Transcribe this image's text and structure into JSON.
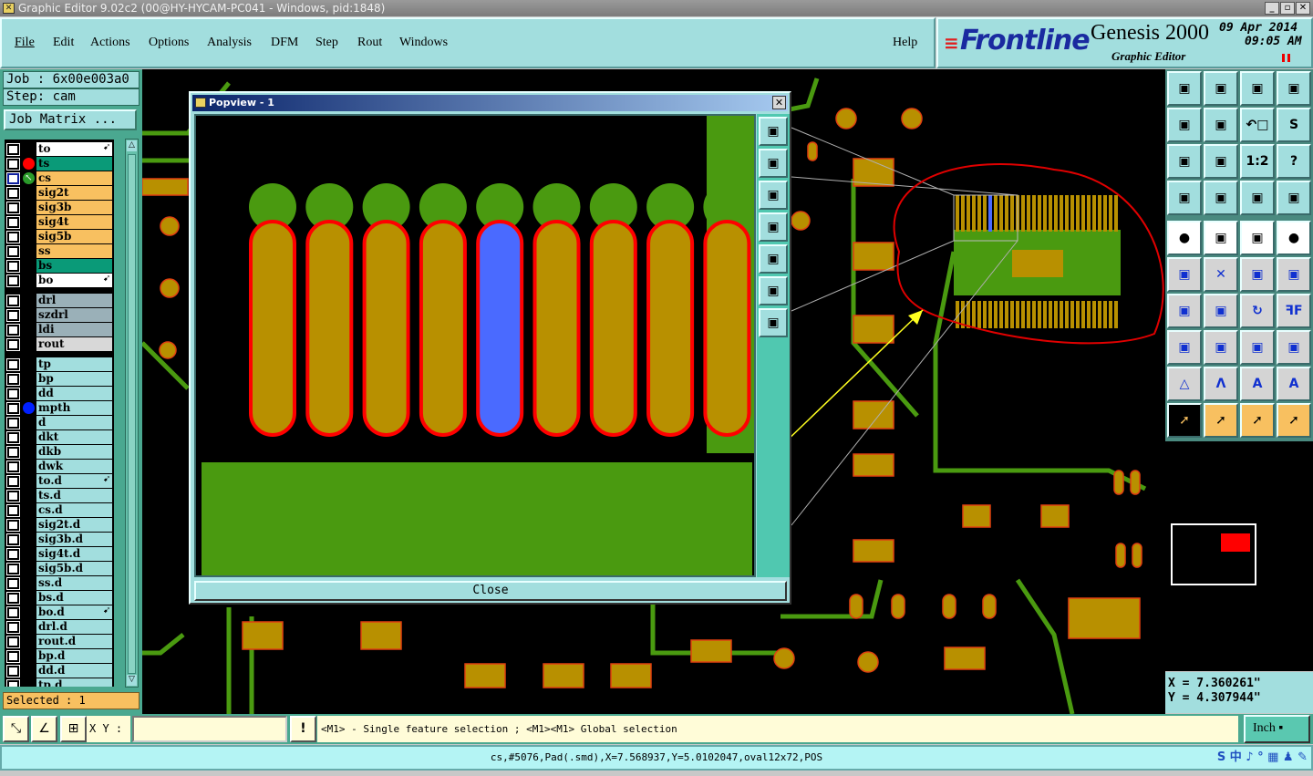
{
  "window": {
    "title": "Graphic Editor 9.02c2 (00@HY-HYCAM-PC041 - Windows, pid:1848)",
    "minimize": "_",
    "restore": "▫",
    "close": "✕"
  },
  "menu": {
    "items": [
      "File",
      "Edit",
      "Actions",
      "Options",
      "Analysis",
      "DFM",
      "Step",
      "Rout",
      "Windows"
    ],
    "help": "Help"
  },
  "logo": {
    "brand": "Frontline",
    "product": "Genesis 2000",
    "subtitle": "Graphic Editor",
    "date": "09 Apr 2014",
    "time": "09:05 AM"
  },
  "job": {
    "job_label": "Job : 6x00e003a0",
    "step_label": "Step: cam",
    "matrix_button": "Job Matrix ..."
  },
  "layers": [
    {
      "name": "to",
      "color": "#ffffff",
      "mark": true
    },
    {
      "name": "ts",
      "color": "#0a9a78",
      "dot": "#ff0000"
    },
    {
      "name": "cs",
      "color": "#f8c060",
      "work": true
    },
    {
      "name": "sig2t",
      "color": "#f8c060"
    },
    {
      "name": "sig3b",
      "color": "#f8c060"
    },
    {
      "name": "sig4t",
      "color": "#f8c060"
    },
    {
      "name": "sig5b",
      "color": "#f8c060"
    },
    {
      "name": "ss",
      "color": "#f8c060"
    },
    {
      "name": "bs",
      "color": "#0a9a78"
    },
    {
      "name": "bo",
      "color": "#ffffff",
      "mark": true
    },
    {
      "name": "drl",
      "color": "#9ab0b8",
      "gap": true
    },
    {
      "name": "szdrl",
      "color": "#9ab0b8"
    },
    {
      "name": "ldi",
      "color": "#9ab0b8"
    },
    {
      "name": "rout",
      "color": "#d8d8d8"
    },
    {
      "name": "tp",
      "color": "#a2dede",
      "gap": true
    },
    {
      "name": "bp",
      "color": "#a2dede"
    },
    {
      "name": "dd",
      "color": "#a2dede"
    },
    {
      "name": "mpth",
      "color": "#a2dede",
      "dot": "#0020ff"
    },
    {
      "name": "d",
      "color": "#a2dede"
    },
    {
      "name": "dkt",
      "color": "#a2dede"
    },
    {
      "name": "dkb",
      "color": "#a2dede"
    },
    {
      "name": "dwk",
      "color": "#a2dede"
    },
    {
      "name": "to.d",
      "color": "#a2dede",
      "mark": true
    },
    {
      "name": "ts.d",
      "color": "#a2dede"
    },
    {
      "name": "cs.d",
      "color": "#a2dede"
    },
    {
      "name": "sig2t.d",
      "color": "#a2dede"
    },
    {
      "name": "sig3b.d",
      "color": "#a2dede"
    },
    {
      "name": "sig4t.d",
      "color": "#a2dede"
    },
    {
      "name": "sig5b.d",
      "color": "#a2dede"
    },
    {
      "name": "ss.d",
      "color": "#a2dede"
    },
    {
      "name": "bs.d",
      "color": "#a2dede"
    },
    {
      "name": "bo.d",
      "color": "#a2dede",
      "mark": true
    },
    {
      "name": "drl.d",
      "color": "#a2dede"
    },
    {
      "name": "rout.d",
      "color": "#a2dede"
    },
    {
      "name": "bp.d",
      "color": "#a2dede"
    },
    {
      "name": "dd.d",
      "color": "#a2dede"
    },
    {
      "name": "tp.d",
      "color": "#a2dede"
    }
  ],
  "selected": "Selected : 1",
  "popview": {
    "title": "Popview - 1",
    "close_button": "Close",
    "tools": [
      "zoom-fit-icon",
      "pan-up-icon",
      "pan-down-icon",
      "pan-left-icon",
      "pan-right-icon",
      "zoom-out-icon",
      "zoom-in-icon"
    ]
  },
  "toolbar": [
    {
      "icon": "pan-up-icon",
      "s": ""
    },
    {
      "icon": "pan-down-icon",
      "s": ""
    },
    {
      "icon": "home-icon",
      "s": ""
    },
    {
      "icon": "grid-xy-icon",
      "s": ""
    },
    {
      "icon": "pan-left-icon",
      "s": ""
    },
    {
      "icon": "pan-right-icon",
      "s": ""
    },
    {
      "icon": "undo-zoom-icon",
      "s": "↶□"
    },
    {
      "icon": "snap-icon",
      "s": "S"
    },
    {
      "icon": "zoom-out-icon",
      "s": ""
    },
    {
      "icon": "zoom-in-icon",
      "s": ""
    },
    {
      "icon": "scale-icon",
      "s": "1:2"
    },
    {
      "icon": "help-icon",
      "s": "?"
    },
    {
      "icon": "tools-icon",
      "s": ""
    },
    {
      "icon": "grid-icon",
      "s": ""
    },
    {
      "icon": "netlist-icon",
      "s": ""
    },
    {
      "icon": "netlist-red-icon",
      "s": ""
    },
    {
      "icon": "add-pad-icon",
      "s": "●"
    },
    {
      "icon": "polygon-icon",
      "s": ""
    },
    {
      "icon": "measure-icon",
      "s": ""
    },
    {
      "icon": "pad-select-icon",
      "s": "●"
    },
    {
      "icon": "connect-icon",
      "s": ""
    },
    {
      "icon": "delete-icon",
      "s": "✕"
    },
    {
      "icon": "move-icon",
      "s": ""
    },
    {
      "icon": "move-filled-icon",
      "s": ""
    },
    {
      "icon": "line-icon",
      "s": ""
    },
    {
      "icon": "line-move-icon",
      "s": ""
    },
    {
      "icon": "rotate-icon",
      "s": "↻"
    },
    {
      "icon": "mirror-icon",
      "s": "ꟻF"
    },
    {
      "icon": "copy-icon",
      "s": ""
    },
    {
      "icon": "segment-icon",
      "s": ""
    },
    {
      "icon": "resize-icon",
      "s": ""
    },
    {
      "icon": "merge-icon",
      "s": ""
    },
    {
      "icon": "arc-icon",
      "s": "△"
    },
    {
      "icon": "arc2-icon",
      "s": "Λ"
    },
    {
      "icon": "arc3-icon",
      "s": "A"
    },
    {
      "icon": "arc4-icon",
      "s": "A"
    },
    {
      "icon": "select-pointer-icon",
      "s": "➚"
    },
    {
      "icon": "select-box-icon",
      "s": "➚"
    },
    {
      "icon": "select-poly-icon",
      "s": "➚"
    },
    {
      "icon": "select-net-icon",
      "s": "➚"
    }
  ],
  "coords": {
    "x": "X  =  7.360261\"",
    "y": "Y  =  4.307944\""
  },
  "bottom": {
    "xy_label": "X Y :",
    "xy_value": "",
    "exclaim": "!",
    "hint": "<M1> - Single feature selection ; <M1><M1> Global selection",
    "units": "Inch"
  },
  "status": {
    "text": "cs,#5076,Pad(.smd),X=7.568937,Y=5.0102047,oval12x72,POS",
    "tray": "S 中 ♪ ° ▦ ♟ ✎"
  },
  "colors": {
    "pad": "#b89000",
    "copper": "#4a9a10",
    "outline": "#ff0000",
    "selected": "#4a6aff",
    "annotation": "#ff0000",
    "arrow": "#ffff00"
  }
}
